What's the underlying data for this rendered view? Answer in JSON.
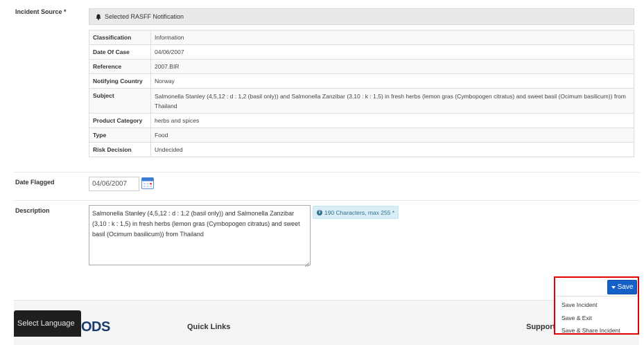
{
  "incident_source": {
    "label": "Incident Source *",
    "header_title": "Selected RASFF Notification",
    "rows": [
      {
        "key": "Classification",
        "value": "Information"
      },
      {
        "key": "Date Of Case",
        "value": "04/06/2007"
      },
      {
        "key": "Reference",
        "value": "2007.BIR"
      },
      {
        "key": "Notifying Country",
        "value": "Norway"
      },
      {
        "key": "Subject",
        "value": "Salmonella Stanley (4,5,12 : d : 1,2 (basil only)) and Salmonella Zanzibar (3,10 : k : 1,5) in fresh herbs (lemon gras (Cymbopogen citratus) and sweet basil (Ocimum basilicum)) from Thailand"
      },
      {
        "key": "Product Category",
        "value": "herbs and spices"
      },
      {
        "key": "Type",
        "value": "Food"
      },
      {
        "key": "Risk Decision",
        "value": "Undecided"
      }
    ]
  },
  "date_flagged": {
    "label": "Date Flagged",
    "value": "04/06/2007"
  },
  "description": {
    "label": "Description",
    "value": "Salmonella Stanley (4,5,12 : d : 1,2 (basil only)) and Salmonella Zanzibar (3,10 : k : 1,5) in fresh herbs (lemon gras (Cymbopogen citratus) and sweet basil (Ocimum basilicum)) from Thailand",
    "char_count": "190 Characters, max 255 *"
  },
  "save_menu": {
    "button_label": "Save",
    "items": [
      "Save Incident",
      "Save & Exit",
      "Save & Share Incident"
    ]
  },
  "footer": {
    "language_button": "Select Language",
    "logo_text": "ODS",
    "quick_links": "Quick Links",
    "support": "Support"
  },
  "colors": {
    "primary": "#1560c7",
    "highlight_frame": "#e00000",
    "info_bg": "#d9edf7",
    "info_text": "#31708f"
  }
}
